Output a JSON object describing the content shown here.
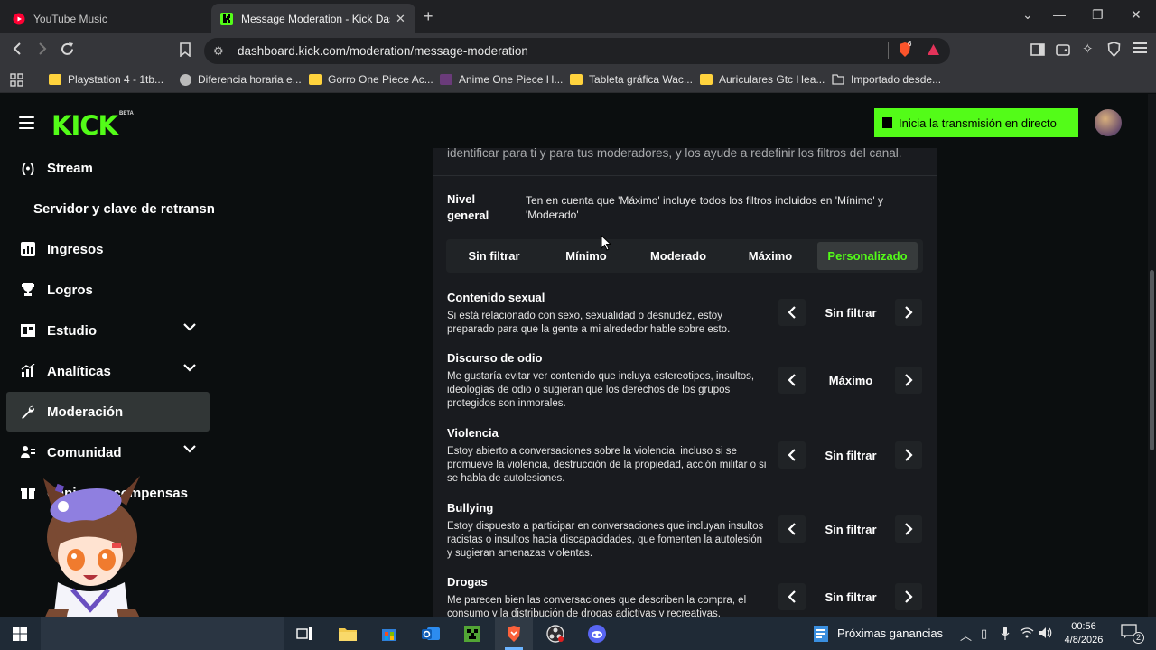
{
  "browser": {
    "tabs": [
      {
        "title": "YouTube Music"
      },
      {
        "title": "Message Moderation - Kick Dashboard"
      }
    ],
    "address": "dashboard.kick.com/moderation/message-moderation",
    "extension_badge": "6",
    "bookmarks": [
      {
        "label": "Playstation 4 - 1tb..."
      },
      {
        "label": "Diferencia horaria e..."
      },
      {
        "label": "Gorro One Piece Ac..."
      },
      {
        "label": "Anime One Piece H..."
      },
      {
        "label": "Tableta gráfica Wac..."
      },
      {
        "label": "Auriculares Gtc Hea..."
      },
      {
        "label": "Importado desde..."
      }
    ]
  },
  "header": {
    "logo": "KICK",
    "logo_badge": "BETA",
    "go_live_label": "Inicia la transmisión en directo"
  },
  "sidebar": {
    "items": [
      {
        "label": "Stream"
      },
      {
        "label": "Servidor y clave de retransn"
      },
      {
        "label": "Ingresos"
      },
      {
        "label": "Logros"
      },
      {
        "label": "Estudio"
      },
      {
        "label": "Analíticas"
      },
      {
        "label": "Moderación"
      },
      {
        "label": "Comunidad"
      },
      {
        "label": "Canjear recompensas"
      }
    ]
  },
  "moderation": {
    "intro": "identificar para ti y para tus moderadores, y los ayude a redefinir los filtros del canal.",
    "level_title": "Nivel general",
    "level_note": "Ten en cuenta que 'Máximo' incluye todos los filtros incluidos en 'Mínimo' y 'Moderado'",
    "levels": [
      "Sin filtrar",
      "Mínimo",
      "Moderado",
      "Máximo",
      "Personalizado"
    ],
    "selected_level": "Personalizado",
    "rules": [
      {
        "title": "Contenido sexual",
        "description": "Si está relacionado con sexo, sexualidad o desnudez, estoy preparado para que la gente a mi alrededor hable sobre esto.",
        "value": "Sin filtrar"
      },
      {
        "title": "Discurso de odio",
        "description": "Me gustaría evitar ver contenido que incluya estereotipos, insultos, ideologías de odio o sugieran que los derechos de los grupos protegidos son inmorales.",
        "value": "Máximo"
      },
      {
        "title": "Violencia",
        "description": "Estoy abierto a conversaciones sobre la violencia, incluso si se promueve la violencia, destrucción de la propiedad, acción militar o si se habla de autolesiones.",
        "value": "Sin filtrar"
      },
      {
        "title": "Bullying",
        "description": "Estoy dispuesto a participar en conversaciones que incluyan insultos racistas o insultos hacia discapacidades, que fomenten la autolesión y sugieran amenazas violentas.",
        "value": "Sin filtrar"
      },
      {
        "title": "Drogas",
        "description": "Me parecen bien las conversaciones que describen la compra, el consumo y la distribución de drogas adictivas y recreativas.",
        "value": "Sin filtrar"
      }
    ]
  },
  "taskbar": {
    "tray_label": "Próximas ganancias",
    "time": "00:56",
    "date": "4/8/2026",
    "notifications": "2"
  },
  "colors": {
    "kick_green": "#53fc18",
    "page_bg": "#0b0e0f",
    "panel_bg": "#191b1f"
  }
}
